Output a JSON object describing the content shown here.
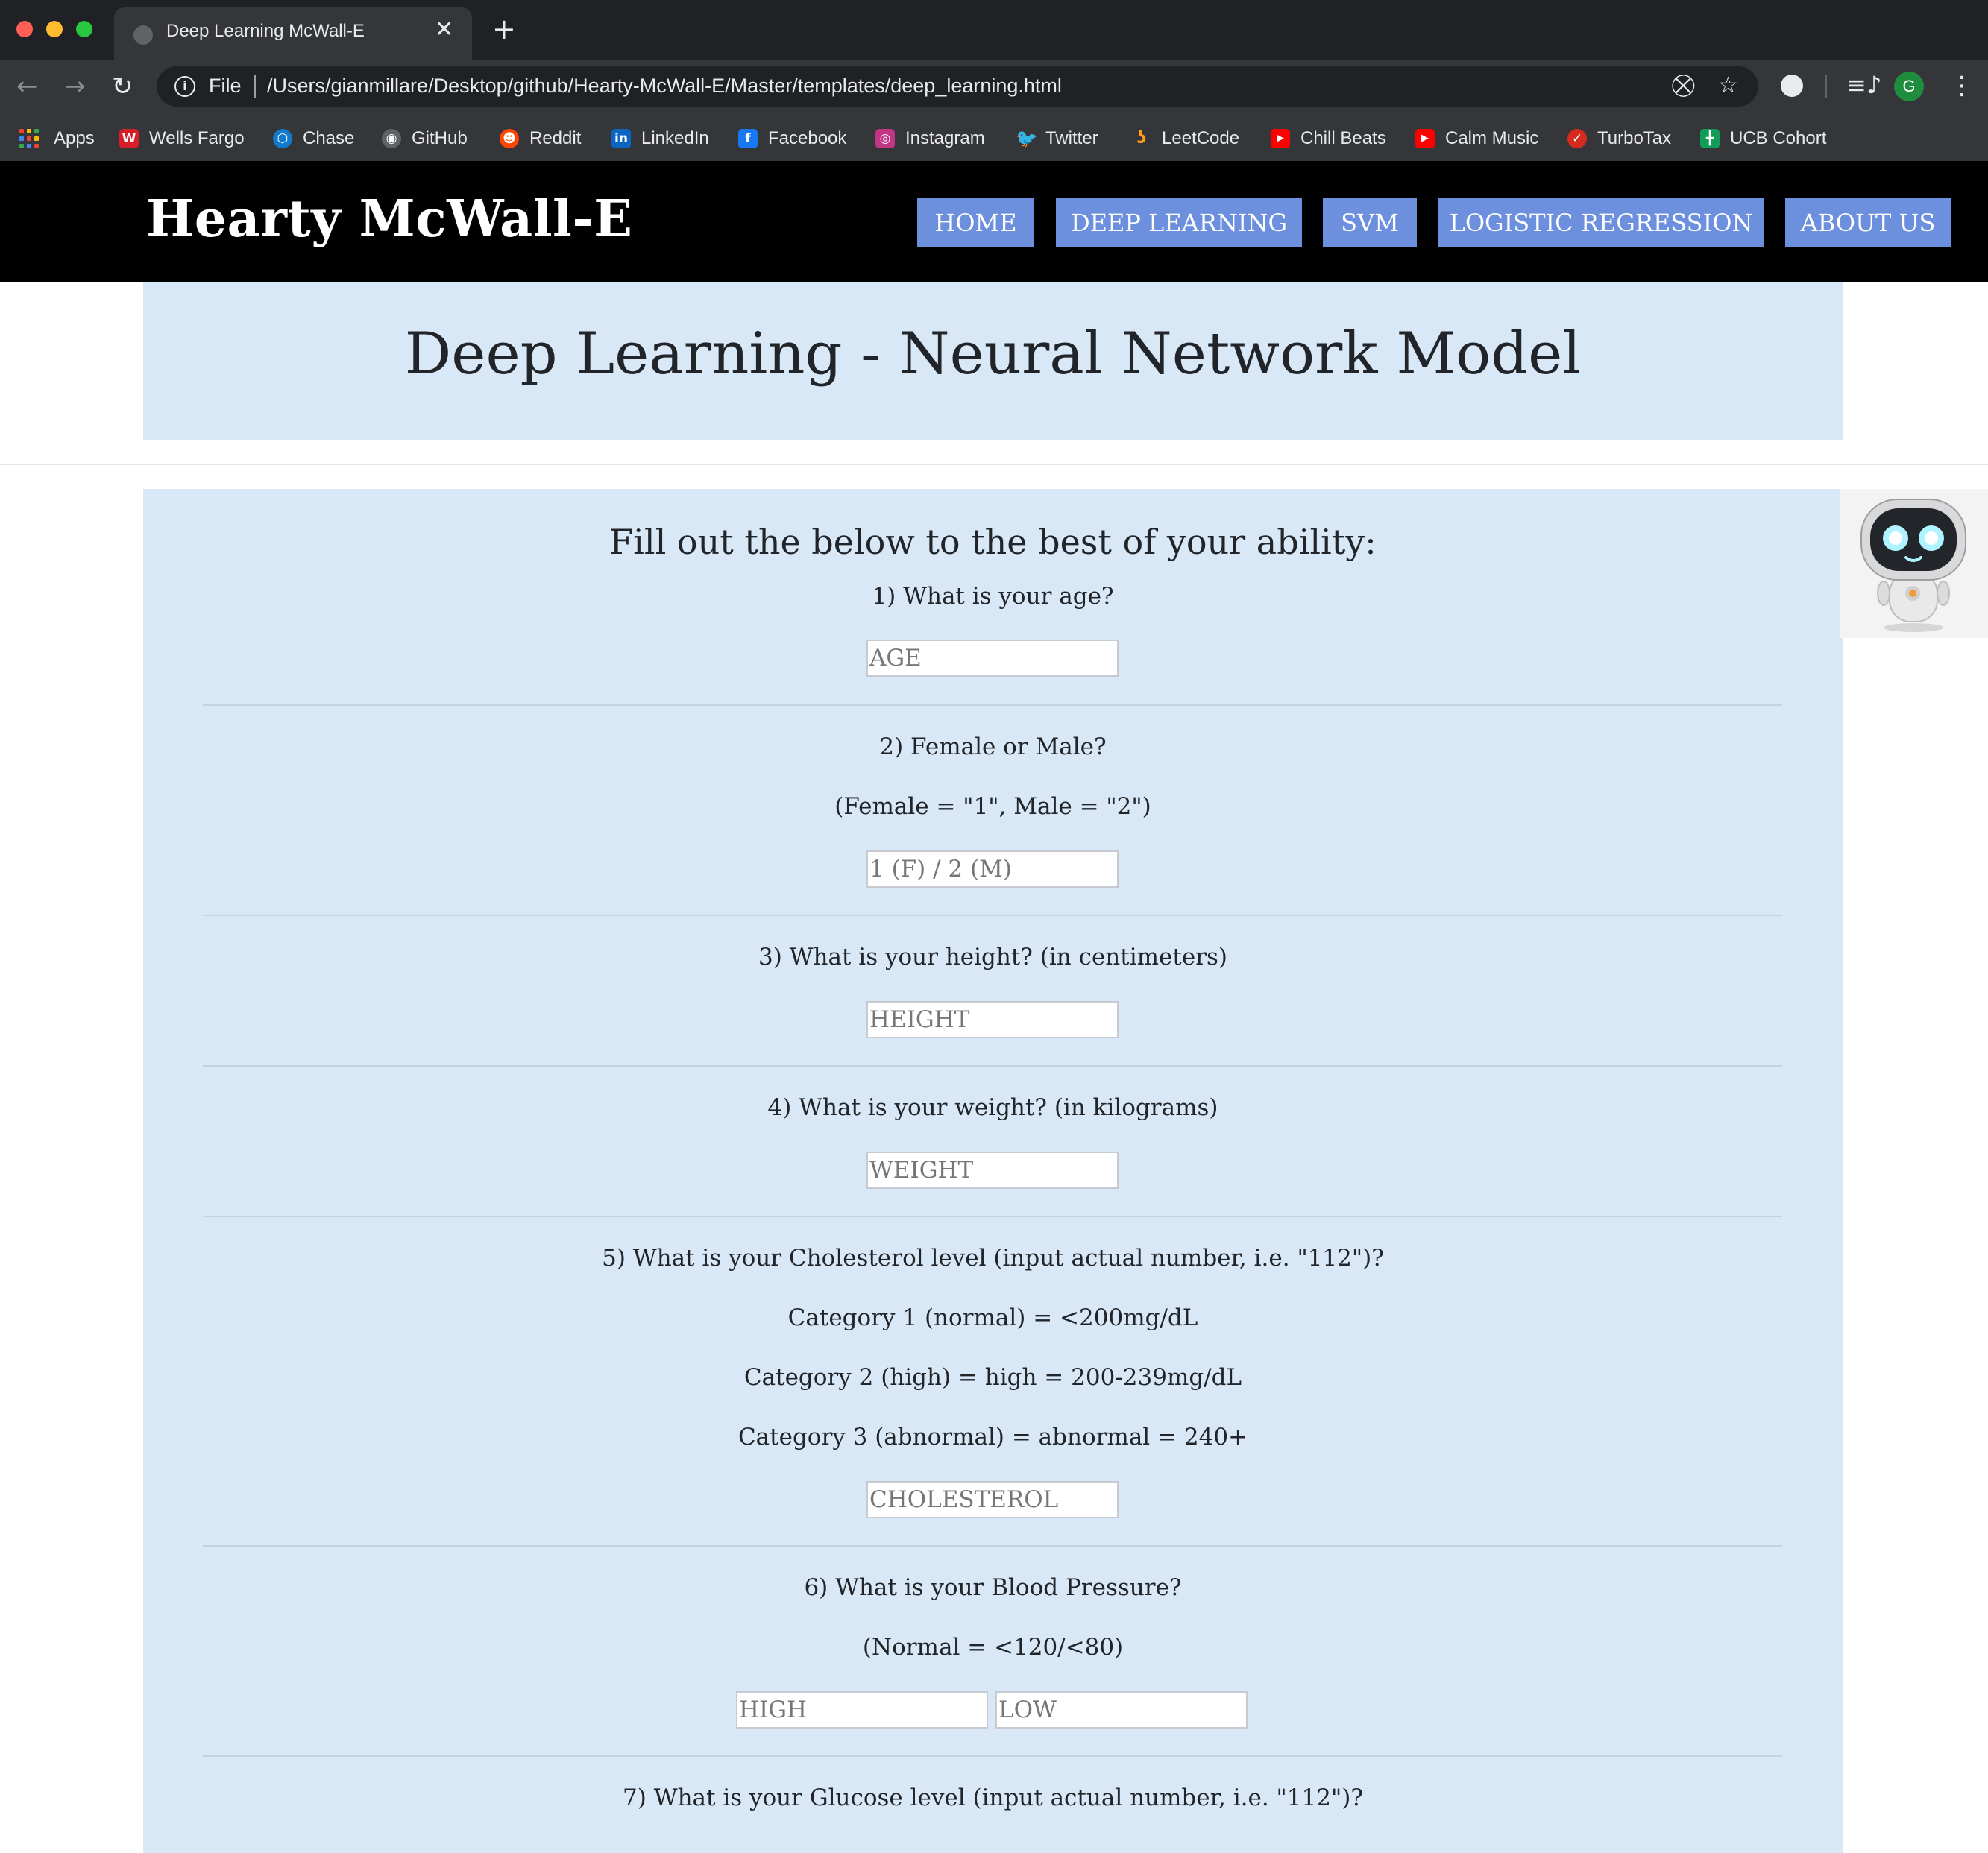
{
  "browser": {
    "tab_title": "Deep Learning McWall-E",
    "scheme_label": "File",
    "url": "/Users/gianmillare/Desktop/github/Hearty-McWall-E/Master/templates/deep_learning.html",
    "profile_initial": "G",
    "bookmarks": [
      {
        "label": "Apps",
        "icon": "apps-grid-icon"
      },
      {
        "label": "Wells Fargo",
        "icon": "wells-fargo-icon",
        "color": "#d71e28"
      },
      {
        "label": "Chase",
        "icon": "chase-icon",
        "color": "#117aca"
      },
      {
        "label": "GitHub",
        "icon": "github-icon",
        "color": "#9aa0a6"
      },
      {
        "label": "Reddit",
        "icon": "reddit-icon",
        "color": "#ff4500"
      },
      {
        "label": "LinkedIn",
        "icon": "linkedin-icon",
        "color": "#0a66c2"
      },
      {
        "label": "Facebook",
        "icon": "facebook-icon",
        "color": "#1877f2"
      },
      {
        "label": "Instagram",
        "icon": "instagram-icon",
        "color": "#c13584"
      },
      {
        "label": "Twitter",
        "icon": "twitter-icon",
        "color": "#1da1f2"
      },
      {
        "label": "LeetCode",
        "icon": "leetcode-icon",
        "color": "#ffa116"
      },
      {
        "label": "Chill Beats",
        "icon": "youtube-icon",
        "color": "#ff0000"
      },
      {
        "label": "Calm Music",
        "icon": "youtube-icon",
        "color": "#ff0000"
      },
      {
        "label": "TurboTax",
        "icon": "turbotax-icon",
        "color": "#d52b1e"
      },
      {
        "label": "UCB Cohort",
        "icon": "google-sheets-icon",
        "color": "#0f9d58"
      }
    ]
  },
  "site": {
    "logo": "Hearty McWall-E",
    "nav": [
      "HOME",
      "DEEP LEARNING",
      "SVM",
      "LOGISTIC REGRESSION",
      "ABOUT US"
    ],
    "accent_color": "#6c8fde",
    "panel_color": "#d9e8f6"
  },
  "page": {
    "title": "Deep Learning - Neural Network Model",
    "form_heading": "Fill out the below to the best of your ability:"
  },
  "questions": {
    "q1": {
      "text": "1) What is your age?",
      "placeholder": "AGE"
    },
    "q2": {
      "text": "2) Female or Male?",
      "note": "(Female = \"1\", Male = \"2\")",
      "placeholder": "1 (F) / 2 (M)"
    },
    "q3": {
      "text": "3) What is your height? (in centimeters)",
      "placeholder": "HEIGHT"
    },
    "q4": {
      "text": "4) What is your weight? (in kilograms)",
      "placeholder": "WEIGHT"
    },
    "q5": {
      "text": "5) What is your Cholesterol level (input actual number, i.e. \"112\")?",
      "cat1": "Category 1 (normal) = <200mg/dL",
      "cat2": "Category 2 (high) = high = 200-239mg/dL",
      "cat3": "Category 3 (abnormal) = abnormal = 240+",
      "placeholder": "CHOLESTEROL"
    },
    "q6": {
      "text": "6) What is your Blood Pressure?",
      "note": "(Normal = <120/<80)",
      "placeholder_high": "HIGH",
      "placeholder_low": "LOW"
    },
    "q7": {
      "text": "7) What is your Glucose level (input actual number, i.e. \"112\")?"
    }
  }
}
